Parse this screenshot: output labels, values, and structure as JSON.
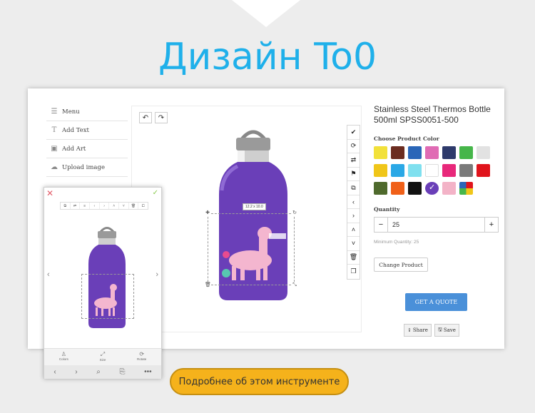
{
  "headline": "Дизайн To0",
  "sidebar": {
    "items": [
      {
        "label": "Menu",
        "icon": "menu-icon",
        "glyph": "☰"
      },
      {
        "label": "Add Text",
        "icon": "text-icon",
        "glyph": "T"
      },
      {
        "label": "Add Art",
        "icon": "image-icon",
        "glyph": "▣"
      },
      {
        "label": "Upload image",
        "icon": "upload-icon",
        "glyph": "☁"
      }
    ]
  },
  "canvas": {
    "undo": "↶",
    "redo": "↷",
    "size_tag": "12.2 x 10.0",
    "tools": [
      {
        "name": "confirm-tool-icon",
        "glyph": "✔"
      },
      {
        "name": "refresh-tool-icon",
        "glyph": "⟳"
      },
      {
        "name": "flip-tool-icon",
        "glyph": "⇄"
      },
      {
        "name": "stamp-tool-icon",
        "glyph": "⚑"
      },
      {
        "name": "align-tool-icon",
        "glyph": "⧉"
      },
      {
        "name": "move-left-icon",
        "glyph": "‹"
      },
      {
        "name": "move-right-icon",
        "glyph": "›"
      },
      {
        "name": "move-up-icon",
        "glyph": "˄"
      },
      {
        "name": "move-down-icon",
        "glyph": "˅"
      },
      {
        "name": "delete-tool-icon",
        "glyph": "🗑"
      },
      {
        "name": "duplicate-tool-icon",
        "glyph": "❐"
      }
    ]
  },
  "product": {
    "title": "Stainless Steel Thermos Bottle 500ml SPSS0051-500",
    "choose_color_label": "Choose Product Color",
    "colors": [
      "#f2e13a",
      "#6b2c1f",
      "#2a66b8",
      "#e06bb4",
      "#2e3a6b",
      "#46b64a",
      "#e2e2e2",
      "#f0c619",
      "#2aa8e6",
      "#7fe0ef",
      "#ffffff",
      "#e8287a",
      "#7a7a7a",
      "#e0141c",
      "#4f6a2d",
      "#f06018",
      "#111111",
      "#6a3fb8",
      "#f3b3c7",
      "multi"
    ],
    "selected_color_index": 17,
    "quantity_label": "Quantity",
    "quantity_minus": "−",
    "quantity_value": "25",
    "quantity_plus": "+",
    "minimum_quantity": "Minimum Quantity: 25",
    "change_product": "Change Product",
    "get_quote": "GET A QUOTE",
    "share": "Share",
    "save": "Save"
  },
  "mobile": {
    "close": "✕",
    "check": "✓",
    "tools": [
      "⧉",
      "⇄",
      "≡",
      "‹",
      "›",
      "˄",
      "˅",
      "🗑",
      "⧠"
    ],
    "prev": "‹",
    "next": "›",
    "bottom": [
      {
        "label": "Colors",
        "glyph": "♙"
      },
      {
        "label": "Size",
        "glyph": "⤢"
      },
      {
        "label": "Rotate",
        "glyph": "⟳"
      }
    ],
    "nav": [
      "‹",
      "›",
      "⌕",
      "⎘",
      "•••"
    ],
    "size_tag": "12.2 x 10.0"
  },
  "cta": "Подробнее об этом инструменте"
}
